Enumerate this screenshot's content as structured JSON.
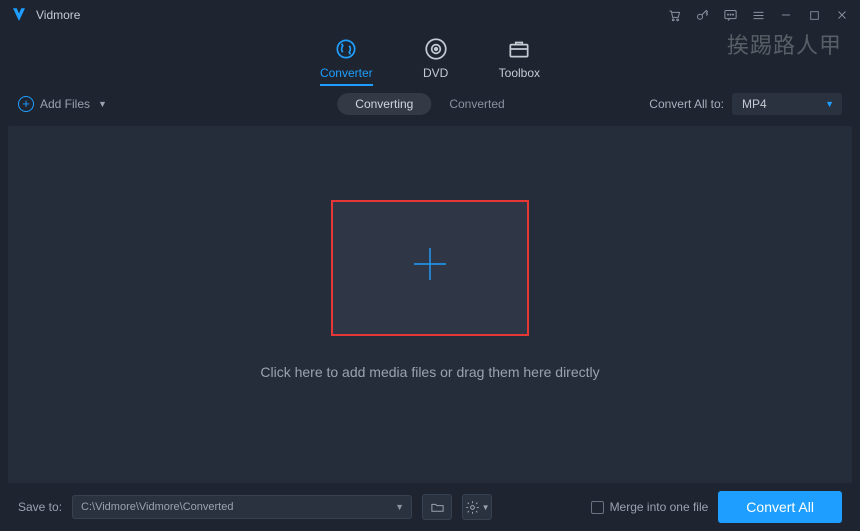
{
  "app": {
    "title": "Vidmore"
  },
  "tabs": {
    "converter": "Converter",
    "dvd": "DVD",
    "toolbox": "Toolbox"
  },
  "toolbar": {
    "add_files": "Add Files",
    "converting": "Converting",
    "converted": "Converted",
    "convert_all_to": "Convert All to:",
    "format": "MP4"
  },
  "main": {
    "hint": "Click here to add media files or drag them here directly"
  },
  "bottom": {
    "save_to": "Save to:",
    "path": "C:\\Vidmore\\Vidmore\\Converted",
    "merge": "Merge into one file",
    "convert_all": "Convert All"
  },
  "watermark": "挨踢路人甲"
}
